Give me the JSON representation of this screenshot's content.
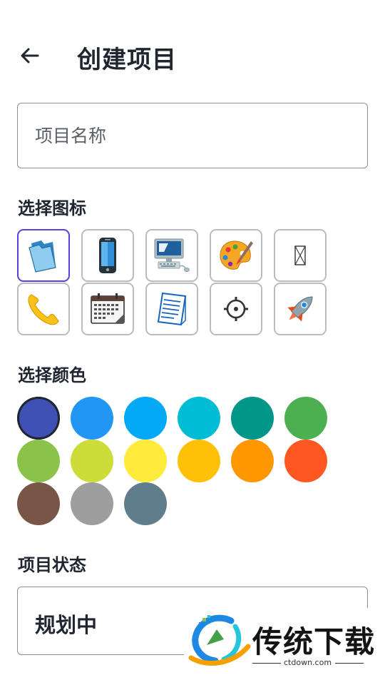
{
  "header": {
    "title": "创建项目",
    "back_icon": "arrow-back-icon"
  },
  "name_field": {
    "value": "",
    "placeholder": "项目名称"
  },
  "icon_section": {
    "label": "选择图标",
    "icons": [
      {
        "name": "folder-icon",
        "selected": true
      },
      {
        "name": "mobile-phone-icon",
        "selected": false
      },
      {
        "name": "desktop-computer-icon",
        "selected": false
      },
      {
        "name": "artist-palette-icon",
        "selected": false
      },
      {
        "name": "missing-glyph-icon",
        "selected": false
      },
      {
        "name": "telephone-receiver-icon",
        "selected": false
      },
      {
        "name": "calendar-icon",
        "selected": false
      },
      {
        "name": "document-icon",
        "selected": false
      },
      {
        "name": "settings-cog-icon",
        "selected": false
      },
      {
        "name": "rocket-icon",
        "selected": false
      }
    ]
  },
  "color_section": {
    "label": "选择颜色",
    "colors": [
      "#3f51b5",
      "#2196f3",
      "#03a9f4",
      "#00bcd4",
      "#009688",
      "#4caf50",
      "#8bc34a",
      "#cddc39",
      "#ffeb3b",
      "#ffc107",
      "#ff9800",
      "#ff5722",
      "#795548",
      "#9e9e9e",
      "#607d8b"
    ],
    "selected_index": 0
  },
  "status_section": {
    "label": "项目状态",
    "value": "规划中"
  },
  "watermark": {
    "name": "传统下载",
    "url": "ctdown.com"
  }
}
